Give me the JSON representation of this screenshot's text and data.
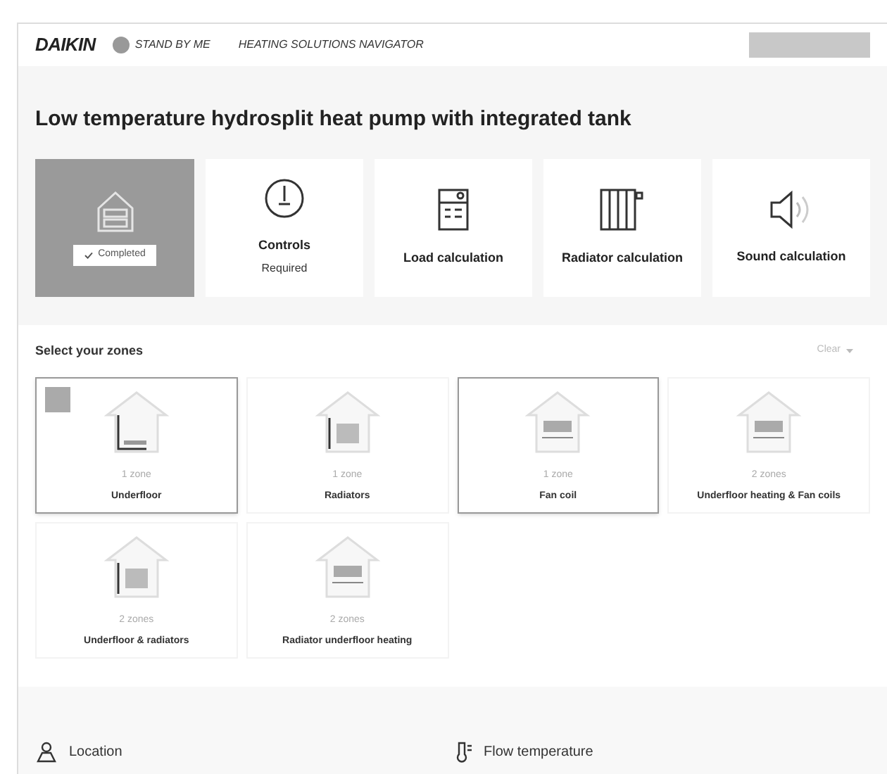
{
  "header": {
    "logo": "DAIKIN",
    "tagline": "STAND BY ME",
    "app_name": "HEATING SOLUTIONS NAVIGATOR"
  },
  "title": "Low temperature hydrosplit heat pump with integrated tank",
  "steps": [
    {
      "kind": "house",
      "status": "Completed",
      "selected": true
    },
    {
      "kind": "gauge",
      "label": "Controls",
      "status": "Required",
      "selected": false
    },
    {
      "kind": "calculator",
      "label": "Load calculation",
      "selected": false
    },
    {
      "kind": "radiator",
      "label": "Radiator calculation",
      "selected": false
    },
    {
      "kind": "speaker",
      "label": "Sound calculation",
      "selected": false
    }
  ],
  "zones_section": {
    "title": "Select your zones",
    "action": "Clear"
  },
  "zones": [
    {
      "kind": "underfloor",
      "count": "1 zone",
      "label": "Underfloor",
      "selected": true,
      "checked": true
    },
    {
      "kind": "radiator",
      "count": "1 zone",
      "label": "Radiators",
      "selected": false,
      "checked": false
    },
    {
      "kind": "fancoil",
      "count": "1 zone",
      "label": "Fan coil",
      "selected": true,
      "checked": false
    },
    {
      "kind": "fancoil",
      "count": "2 zones",
      "label": "Underfloor heating & Fan coils",
      "selected": false,
      "checked": false
    },
    {
      "kind": "radiator",
      "count": "2 zones",
      "label": "Underfloor & radiators",
      "selected": false,
      "checked": false
    },
    {
      "kind": "fancoil",
      "count": "2 zones",
      "label": "Radiator underfloor heating",
      "selected": false,
      "checked": false
    }
  ],
  "footer": [
    {
      "kind": "location",
      "label": "Location"
    },
    {
      "kind": "thermometer",
      "label": "Flow temperature"
    }
  ]
}
